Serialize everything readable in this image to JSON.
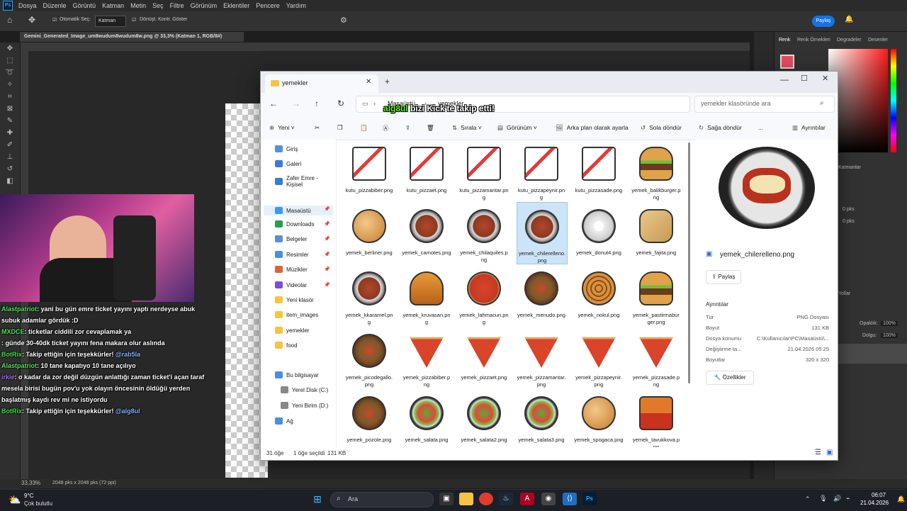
{
  "photoshop": {
    "logo": "Ps",
    "menu": [
      "Dosya",
      "Düzenle",
      "Görüntü",
      "Katman",
      "Metin",
      "Seç",
      "Filtre",
      "Görünüm",
      "Eklentiler",
      "Pencere",
      "Yardım"
    ],
    "auto_select_label": "Otomatik Seç:",
    "layer_select": "Katman",
    "transform_label": "Dönüşt. Kontr. Göster",
    "share_label": "Paylaş",
    "doc_tab": "Gemini_Generated_Image_um8wudum8wudum8w.png @ 33,3% (Katman 1, RGB/8#)",
    "zoom": "33,33%",
    "doc_size": "2048 pks x 2048 pks (72 ppi)",
    "panel_tabs": [
      "Renk",
      "Renk Örnekleri",
      "Degradeler",
      "Desenler"
    ],
    "panel_labels": {
      "layers": "Katmanlar",
      "layers2": "Yollar",
      "opacity": "Opaklık:",
      "fill": "Dolgu:",
      "opacity_val": "100%",
      "fill_val": "100%",
      "pks1": "0 pks",
      "pks2": "0 pks"
    }
  },
  "chat": [
    {
      "user": "Alastpatriot",
      "text": ": yani bu gün emre ticket yayını yaptı nerdeyse abuk subuk adamlar gördük :D"
    },
    {
      "user": "MXDCE",
      "text": ": ticketlar ciddili zor cevaplamak ya"
    },
    {
      "user": "",
      "text": ": günde 30-40dk ticket yayını fena makara olur aslında"
    },
    {
      "user": "BotRix",
      "text": ": Takip ettiğin için teşekkürler! ",
      "mention": "@rab5la"
    },
    {
      "user": "Alastpatriot",
      "text": ": 10 tane kapatıyo 10 tane açılıyo"
    },
    {
      "user": "irkie",
      "text": ": o kadar da zor değil düzgün anlattığı zaman ticket'i açan taraf mesela birisi bugün pov'u yok olayın öncesinin öldüğü yerden başlatmış kaydı rev mi ne istiyordu"
    },
    {
      "user": "BotRix",
      "text": ": Takip ettiğin için teşekkürler! ",
      "mention": "@alg8ul"
    }
  ],
  "kick": {
    "user": "alg8ul",
    "text": " bizi Kick'te takip etti!"
  },
  "explorer": {
    "tab_title": "yemekler",
    "add_tab": "+",
    "breadcrumb": [
      "Masaüstü",
      "yemekler"
    ],
    "search_placeholder": "yemekler klasöründe ara",
    "cmd": {
      "new": "Yeni",
      "sort": "Sırala",
      "view": "Görünüm",
      "bg": "Arka plan olarak ayarla",
      "rotl": "Sola döndür",
      "rotr": "Sağa döndür",
      "more": "...",
      "details": "Ayrıntılar"
    },
    "nav": [
      {
        "label": "Giriş",
        "color": "#5a8fd8"
      },
      {
        "label": "Galeri",
        "color": "#3a7bd5"
      },
      {
        "label": "Zafer Emre - Kişisel",
        "color": "#2f7fd9"
      },
      {
        "label": "Masaüstü",
        "color": "#3a9bf0"
      },
      {
        "label": "Downloads",
        "color": "#2e9c52"
      },
      {
        "label": "Belgeler",
        "color": "#5a8fd8"
      },
      {
        "label": "Resimler",
        "color": "#4a8fe0"
      },
      {
        "label": "Müzikler",
        "color": "#e0623a"
      },
      {
        "label": "Videolar",
        "color": "#7a4fd8"
      },
      {
        "label": "Yeni klasör",
        "color": "#f5c443"
      },
      {
        "label": "item_images",
        "color": "#f5c443"
      },
      {
        "label": "yemekler",
        "color": "#f5c443"
      },
      {
        "label": "food",
        "color": "#f5c443"
      },
      {
        "label": "Bu bilgisayar",
        "color": "#4a8fe0"
      },
      {
        "label": "Yerel Disk (C:)",
        "color": "#888"
      },
      {
        "label": "Yeni Birim (D:)",
        "color": "#888"
      },
      {
        "label": "Ağ",
        "color": "#4a8fe0"
      }
    ],
    "files": [
      {
        "name": "kutu_pizzabiber.png",
        "kind": "box"
      },
      {
        "name": "kutu_pizzaet.png",
        "kind": "box"
      },
      {
        "name": "kutu_pizzamantar.png",
        "kind": "box"
      },
      {
        "name": "kutu_pizzapeynir.png",
        "kind": "box"
      },
      {
        "name": "kutu_pizzasade.png",
        "kind": "box"
      },
      {
        "name": "yemek_balikburger.png",
        "kind": "burger"
      },
      {
        "name": "yemek_berliner.png",
        "kind": "bun"
      },
      {
        "name": "yemek_camotes.png",
        "kind": "plate"
      },
      {
        "name": "yemek_chilaquiles.png",
        "kind": "plate"
      },
      {
        "name": "yemek_chilerelleno.png",
        "kind": "plate"
      },
      {
        "name": "yemek_donut4.png",
        "kind": "donut"
      },
      {
        "name": "yemek_fajita.png",
        "kind": "wrap"
      },
      {
        "name": "yemek_kkaramel.png",
        "kind": "plate"
      },
      {
        "name": "yemek_kruvasan.png",
        "kind": "croissant"
      },
      {
        "name": "yemek_lahmacun.png",
        "kind": "pizza"
      },
      {
        "name": "yemek_menudo.png",
        "kind": "bowl"
      },
      {
        "name": "yemek_nokul.png",
        "kind": "roll"
      },
      {
        "name": "yemek_pastirmaburger.png",
        "kind": "burger"
      },
      {
        "name": "yemek_picodegallo.png",
        "kind": "bowl"
      },
      {
        "name": "yemek_pizzabiber.png",
        "kind": "slice"
      },
      {
        "name": "yemek_pizzaet.png",
        "kind": "slice"
      },
      {
        "name": "yemek_pizzamantar.png",
        "kind": "slice"
      },
      {
        "name": "yemek_pizzapeynir.png",
        "kind": "slice"
      },
      {
        "name": "yemek_pizzasade.png",
        "kind": "slice"
      },
      {
        "name": "yemek_pozole.png",
        "kind": "bowl"
      },
      {
        "name": "yemek_salata.png",
        "kind": "salad"
      },
      {
        "name": "yemek_salata2.png",
        "kind": "salad"
      },
      {
        "name": "yemek_salata3.png",
        "kind": "salad"
      },
      {
        "name": "yemek_spogaca.png",
        "kind": "bun"
      },
      {
        "name": "yemek_tavukkova.png",
        "kind": "box2"
      }
    ],
    "selected_index": 9,
    "details": {
      "filename": "yemek_chilerelleno.png",
      "share": "Paylaş",
      "section": "Ayrıntılar",
      "rows": [
        {
          "label": "Tür",
          "value": "PNG Dosyası"
        },
        {
          "label": "Boyut",
          "value": "131 KB"
        },
        {
          "label": "Dosya konumu",
          "value": "C:\\Kullanıcılar\\PC\\Masaüstü\\..."
        },
        {
          "label": "Değiştirme ta...",
          "value": "21.04.2026 05:25"
        },
        {
          "label": "Boyutlar",
          "value": "320 x 320"
        }
      ],
      "properties": "Özellikler"
    },
    "status": {
      "count": "31 öğe",
      "selected": "1 öğe seçildi",
      "size": "131 KB"
    }
  },
  "taskbar": {
    "weather_temp": "9°C",
    "weather_desc": "Çok bulutlu",
    "search": "Ara",
    "time": "06:07",
    "date": "21.04.2026"
  },
  "colors": {
    "accent": "#1473e6",
    "kick_green": "#53fc18",
    "selection": "#cce4f7"
  }
}
